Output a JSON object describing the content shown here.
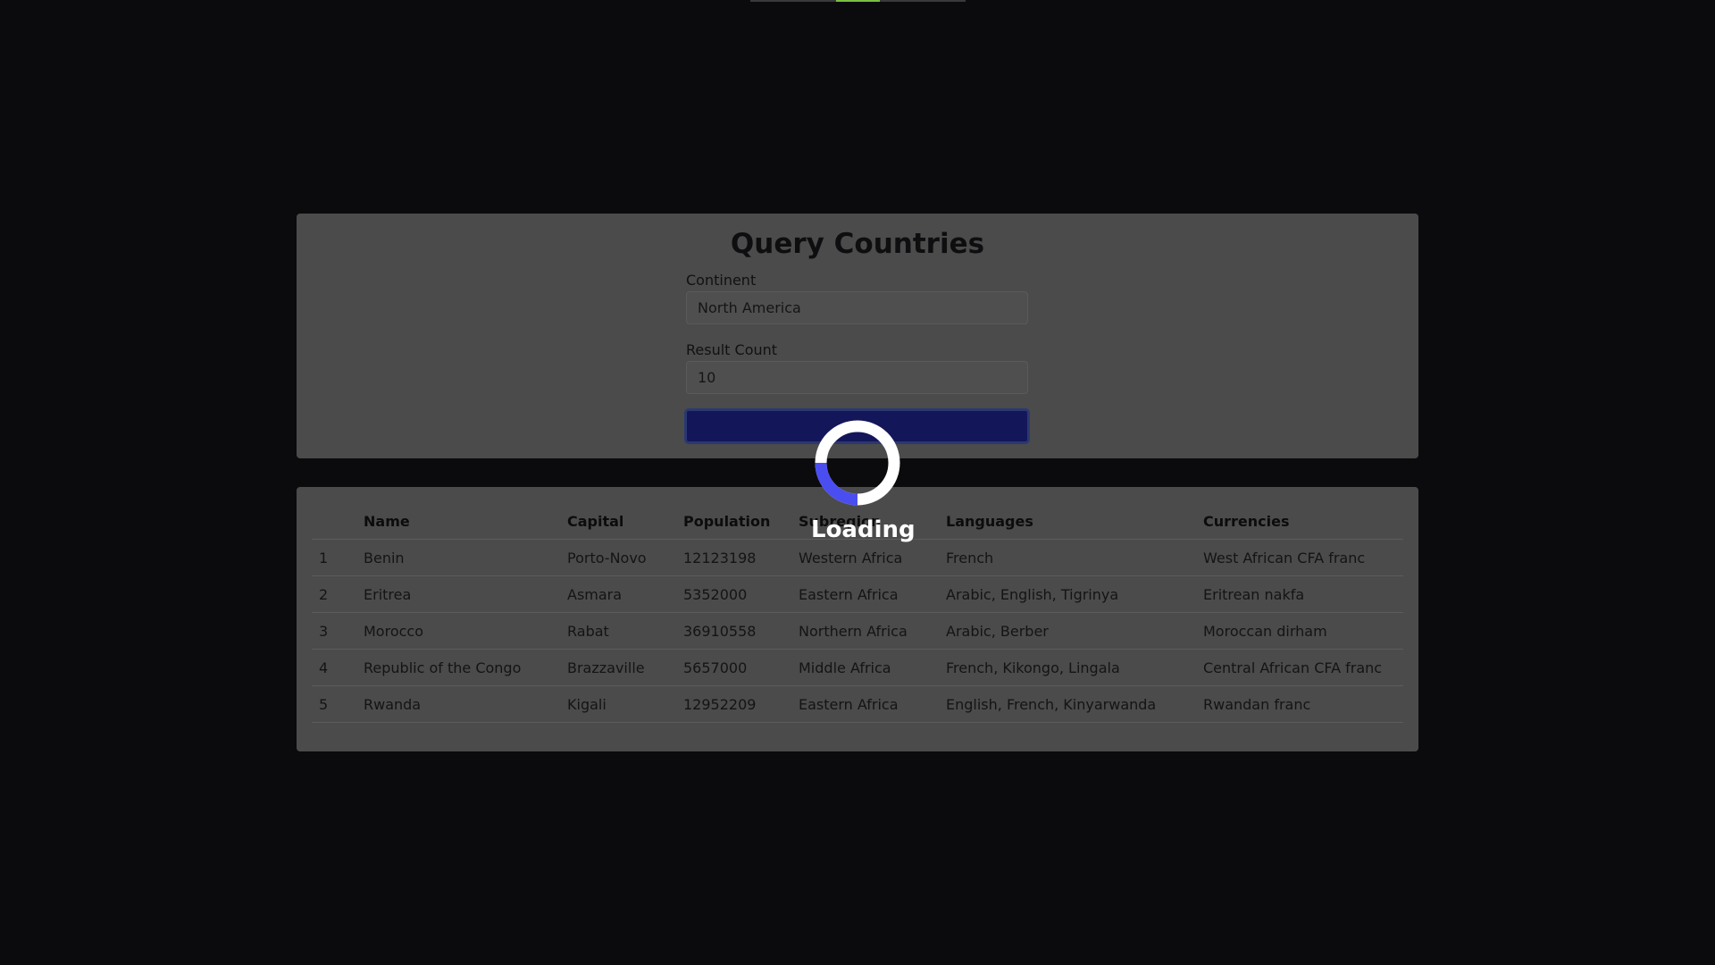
{
  "query": {
    "title": "Query Countries",
    "continent_label": "Continent",
    "continent_value": "North America",
    "count_label": "Result Count",
    "count_value": "10",
    "submit_label": ""
  },
  "table": {
    "headers": [
      "",
      "Name",
      "Capital",
      "Population",
      "Subregion",
      "Languages",
      "Currencies"
    ],
    "rows": [
      [
        "1",
        "Benin",
        "Porto-Novo",
        "12123198",
        "Western Africa",
        "French",
        "West African CFA franc"
      ],
      [
        "2",
        "Eritrea",
        "Asmara",
        "5352000",
        "Eastern Africa",
        "Arabic, English, Tigrinya",
        "Eritrean nakfa"
      ],
      [
        "3",
        "Morocco",
        "Rabat",
        "36910558",
        "Northern Africa",
        "Arabic, Berber",
        "Moroccan dirham"
      ],
      [
        "4",
        "Republic of the Congo",
        "Brazzaville",
        "5657000",
        "Middle Africa",
        "French, Kikongo, Lingala",
        "Central African CFA franc"
      ],
      [
        "5",
        "Rwanda",
        "Kigali",
        "12952209",
        "Eastern Africa",
        "English, French, Kinyarwanda",
        "Rwandan franc"
      ]
    ]
  },
  "loading": {
    "label": "Loading",
    "icon": "spinner-icon"
  },
  "colors": {
    "background": "#0b0b0d",
    "card": "#4b4b4c",
    "button": "#14165a",
    "spinner_accent": "#4a4ef0",
    "progress_accent": "#7bc043"
  }
}
